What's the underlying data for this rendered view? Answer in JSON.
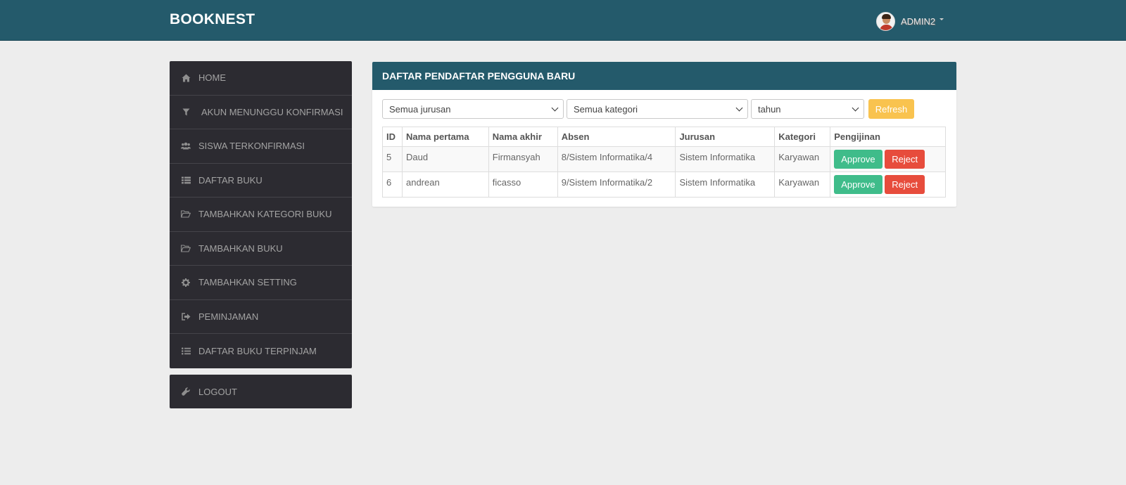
{
  "app": {
    "brand": "BOOKNEST"
  },
  "user": {
    "name": "ADMIN2"
  },
  "sidebar": {
    "items": [
      {
        "label": "HOME",
        "icon": "home-icon"
      },
      {
        "label": "AKUN MENUNGGU KONFIRMASI",
        "icon": "filter-icon"
      },
      {
        "label": "SISWA TERKONFIRMASI",
        "icon": "users-icon"
      },
      {
        "label": "DAFTAR BUKU",
        "icon": "list-icon"
      },
      {
        "label": "TAMBAHKAN KATEGORI BUKU",
        "icon": "folder-open-icon"
      },
      {
        "label": "TAMBAHKAN BUKU",
        "icon": "folder-open-icon"
      },
      {
        "label": "TAMBAHKAN SETTING",
        "icon": "gear-icon"
      },
      {
        "label": "PEMINJAMAN",
        "icon": "sign-out-icon"
      },
      {
        "label": "DAFTAR BUKU TERPINJAM",
        "icon": "list-ul-icon"
      }
    ],
    "logout": {
      "label": "LOGOUT",
      "icon": "wrench-icon"
    }
  },
  "panel": {
    "title": "DAFTAR PENDAFTAR PENGGUNA BARU",
    "filters": {
      "jurusan": "Semua jurusan",
      "kategori": "Semua kategori",
      "tahun": "tahun",
      "refresh_label": "Refresh"
    },
    "table": {
      "headers": [
        "ID",
        "Nama pertama",
        "Nama akhir",
        "Absen",
        "Jurusan",
        "Kategori",
        "Pengijinan"
      ],
      "rows": [
        {
          "id": "5",
          "first": "Daud",
          "last": "Firmansyah",
          "absen": "8/Sistem Informatika/4",
          "jurusan": "Sistem Informatika",
          "kategori": "Karyawan"
        },
        {
          "id": "6",
          "first": "andrean",
          "last": "ficasso",
          "absen": "9/Sistem Informatika/2",
          "jurusan": "Sistem Informatika",
          "kategori": "Karyawan"
        }
      ],
      "approve_label": "Approve",
      "reject_label": "Reject"
    }
  },
  "colors": {
    "navbar": "#245a6b",
    "sidebar": "#2c2b31",
    "approve": "#3fbc8a",
    "reject": "#e74c3c",
    "refresh": "#f9c34f"
  }
}
